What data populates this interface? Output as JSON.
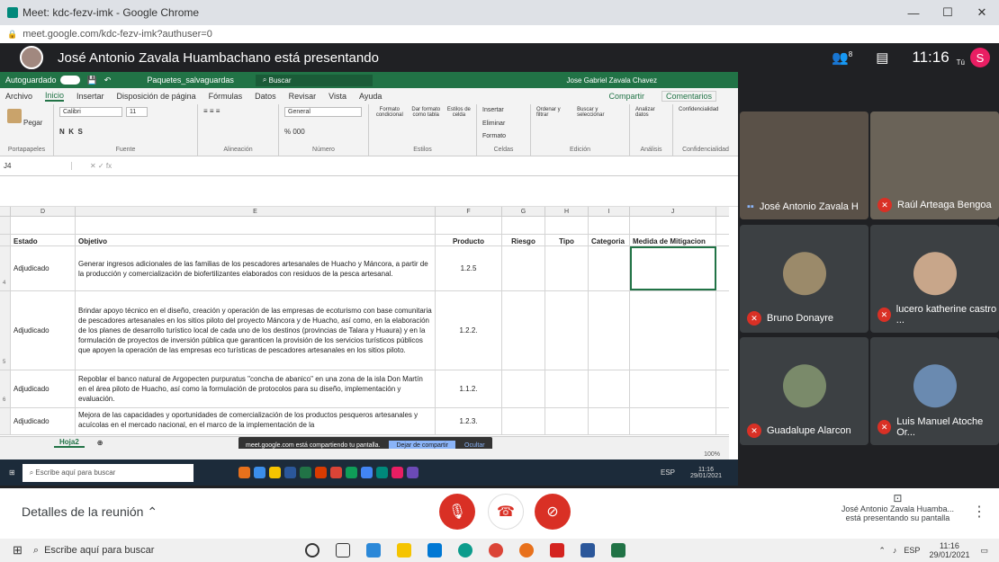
{
  "browser": {
    "tab_title": "Meet: kdc-fezv-imk - Google Chrome",
    "url": "meet.google.com/kdc-fezv-imk?authuser=0",
    "controls": [
      "—",
      "☐",
      "✕"
    ]
  },
  "meet_header": {
    "presenting": "José Antonio Zavala Huambachano está presentando",
    "participants_count": "8",
    "time": "11:16",
    "you_label": "Tú",
    "avatar_letter": "S"
  },
  "excel": {
    "autosave": "Autoguardado",
    "filename": "Paquetes_salvaguardas",
    "search": "Buscar",
    "user": "Jose Gabriel Zavala Chavez",
    "menu": [
      "Archivo",
      "Inicio",
      "Insertar",
      "Disposición de página",
      "Fórmulas",
      "Datos",
      "Revisar",
      "Vista",
      "Ayuda"
    ],
    "share": "Compartir",
    "comments": "Comentarios",
    "ribbon": {
      "clipboard": "Portapapeles",
      "paste": "Pegar",
      "font_label": "Fuente",
      "font_name": "Calibri",
      "font_size": "11",
      "alignment": "Alineación",
      "number_label": "Número",
      "number_format": "General",
      "styles_label": "Estilos",
      "cond_format": "Formato condicional",
      "format_table": "Dar formato como tabla",
      "cell_styles": "Estilos de celda",
      "cells_label": "Celdas",
      "insert": "Insertar",
      "delete": "Eliminar",
      "format": "Formato",
      "edit_label": "Edición",
      "sort_filter": "Ordenar y filtrar",
      "find_select": "Buscar y seleccionar",
      "analysis_label": "Análisis",
      "analyze": "Analizar datos",
      "confidentiality": "Confidencialidad"
    },
    "name_box": "J4",
    "columns": [
      "D",
      "E",
      "F",
      "G",
      "H",
      "I",
      "J"
    ],
    "headers": {
      "estado": "Estado",
      "objetivo": "Objetivo",
      "producto": "Producto",
      "riesgo": "Riesgo",
      "tipo": "Tipo",
      "categoria": "Categoria",
      "medida": "Medida de Mitigacion"
    },
    "rows": [
      {
        "num": "4",
        "estado": "Adjudicado",
        "objetivo": "Generar ingresos adicionales de las familias de los pescadores artesanales de Huacho y Máncora, a partir de la producción y comercialización de biofertilizantes elaborados con residuos de la pesca artesanal.",
        "producto": "1.2.5"
      },
      {
        "num": "5",
        "estado": "Adjudicado",
        "objetivo": "Brindar apoyo técnico en el diseño, creación y operación de las empresas de ecoturismo con base comunitaria de pescadores artesanales en los sitios piloto del proyecto Máncora y de Huacho, así como, en la elaboración de los planes de desarrollo turístico local de cada uno de los destinos (provincias de Talara y Huaura) y en la formulación de proyectos de inversión pública que garanticen la provisión de los servicios turísticos públicos que apoyen la operación de las empresas eco turísticas de pescadores artesanales en los sitios piloto.",
        "producto": "1.2.2."
      },
      {
        "num": "6",
        "estado": "Adjudicado",
        "objetivo": "Repoblar el banco natural de Argopecten purpuratus \"concha de abanico\" en una zona de la isla Don Martín en el área piloto de Huacho, así como la formulación de protocolos para su diseño, implementación y evaluación.",
        "producto": "1.1.2."
      },
      {
        "num": "",
        "estado": "Adjudicado",
        "objetivo": "Mejora de las capacidades y oportunidades de comercialización de los productos pesqueros artesanales y acuícolas en el mercado nacional, en el marco de la implementación de la",
        "producto": "1.2.3."
      }
    ],
    "sheet_tab": "Hoja2",
    "zoom": "100%"
  },
  "share_notice": {
    "text": "meet.google.com está compartiendo tu pantalla.",
    "stop": "Dejar de compartir",
    "hide": "Ocultar"
  },
  "inner_taskbar": {
    "search": "Escribe aquí para buscar",
    "lang": "ESP",
    "time": "11:16",
    "date": "29/01/2021"
  },
  "participants": [
    {
      "name": "José Antonio Zavala H",
      "muted": false
    },
    {
      "name": "Raúl Arteaga Bengoa",
      "muted": true
    },
    {
      "name": "Bruno Donayre",
      "muted": true
    },
    {
      "name": "lucero katherine castro ...",
      "muted": true
    },
    {
      "name": "Guadalupe Alarcon",
      "muted": true
    },
    {
      "name": "Luis Manuel Atoche Or...",
      "muted": true
    }
  ],
  "bottom_bar": {
    "details": "Detalles de la reunión",
    "presenting_line1": "José Antonio Zavala Huamba...",
    "presenting_line2": "está presentando su pantalla"
  },
  "taskbar": {
    "search": "Escribe aquí para buscar",
    "lang": "ESP",
    "time": "11:16",
    "date": "29/01/2021"
  },
  "colors": {
    "excel_green": "#217346",
    "meet_dark": "#202124",
    "mute_red": "#d93025"
  }
}
